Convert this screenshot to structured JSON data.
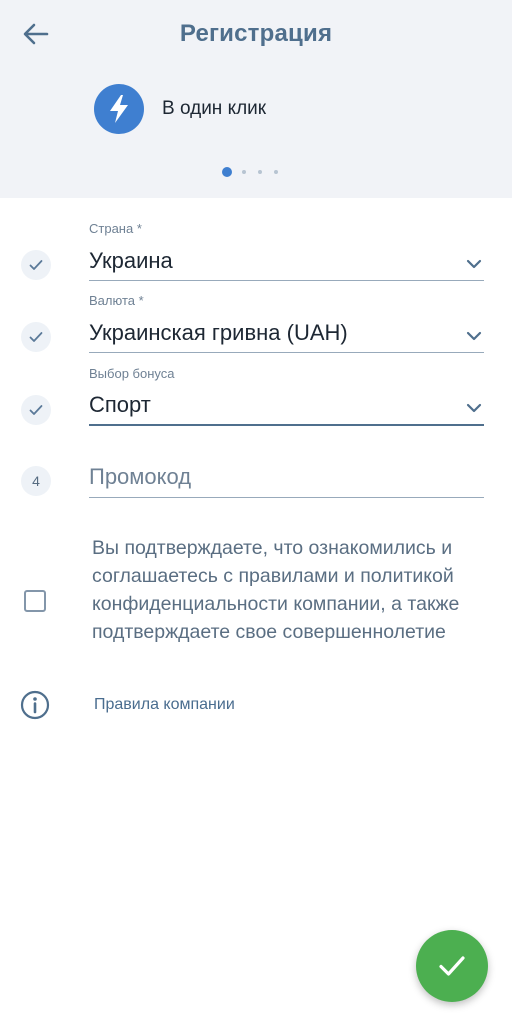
{
  "header": {
    "title": "Регистрация",
    "method_label": "В один клик",
    "pager_dots": 4,
    "active_dot": 0
  },
  "form": {
    "country": {
      "label": "Страна *",
      "value": "Украина",
      "status": "check-icon"
    },
    "currency": {
      "label": "Валюта *",
      "value": "Украинская гривна (UAH)",
      "status": "check-icon"
    },
    "bonus": {
      "label": "Выбор бонуса",
      "value": "Спорт",
      "status": "check-icon"
    },
    "promo": {
      "step": "4",
      "placeholder": "Промокод",
      "value": ""
    }
  },
  "agreement": {
    "text": "Вы подтверждаете, что ознакомились и соглашаетесь с правилами и политикой конфиденциальности компании, а также подтверждаете свое совершеннолетие",
    "checked": false
  },
  "rules_link": "Правила компании",
  "colors": {
    "accent": "#3f7fd0",
    "header_bg": "#f1f3f7",
    "fab": "#4caf50",
    "title": "#4f6f8d"
  }
}
